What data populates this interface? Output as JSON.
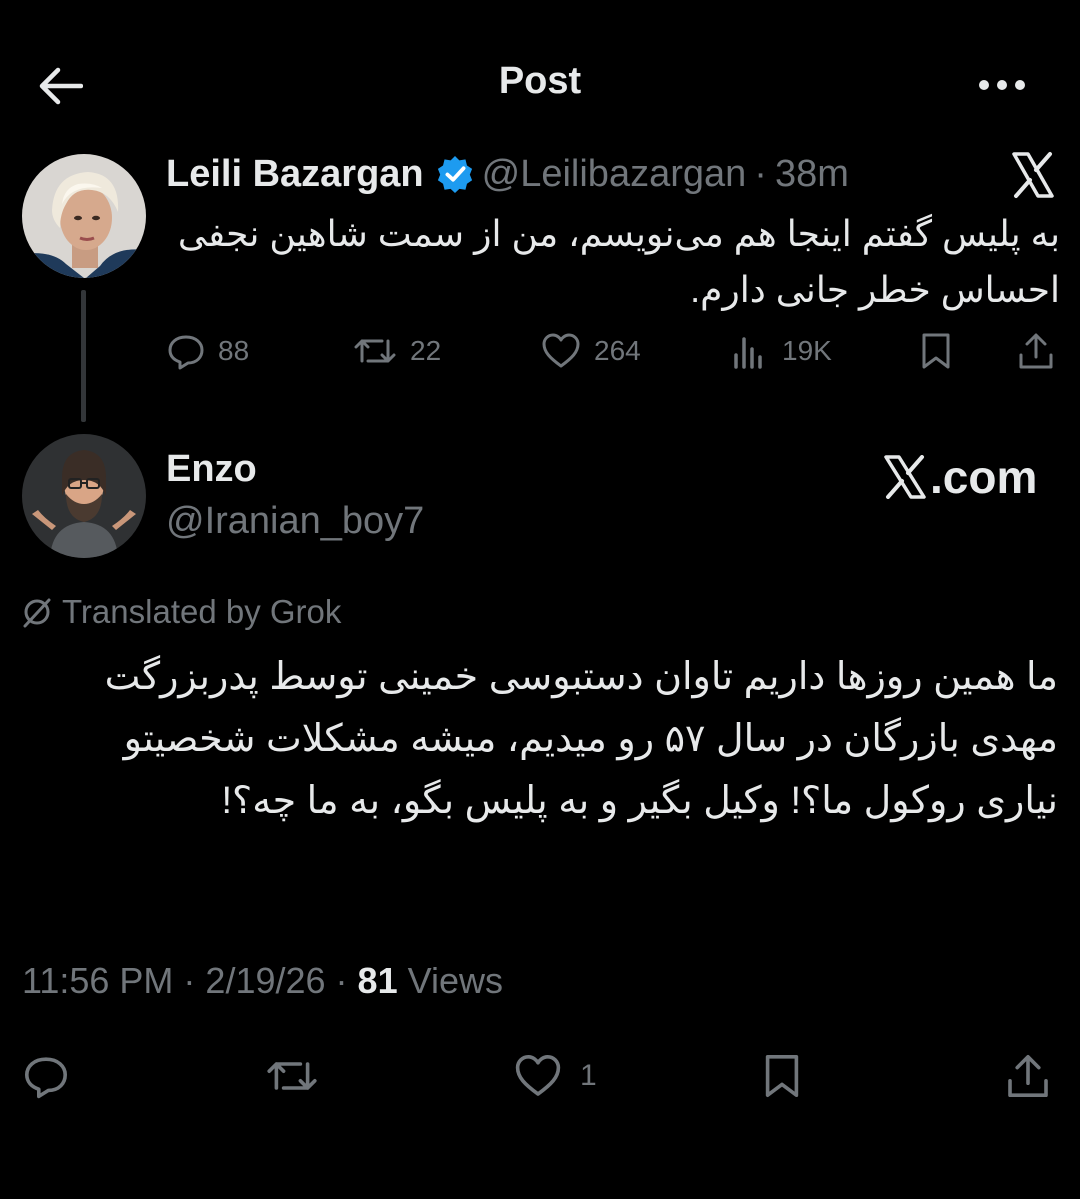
{
  "header": {
    "title": "Post"
  },
  "parent_tweet": {
    "author_name": "Leili Bazargan",
    "handle": "@Leilibazargan",
    "separator": "·",
    "time_ago": "38m",
    "text": "به پلیس گفتم اینجا هم می‌نویسم، من از سمت شاهین نجفی احساس خطر جانی دارم.",
    "stats": {
      "replies": "88",
      "reposts": "22",
      "likes": "264",
      "views": "19K"
    }
  },
  "reply_tweet": {
    "author_name": "Enzo",
    "handle": "@Iranian_boy7",
    "watermark": ".com",
    "translated_label": "Translated by Grok",
    "text": "ما همین روزها داریم تاوان دستبوسی خمینی توسط پدربزرگت مهدی بازرگان در سال ۵۷ رو میدیم، میشه مشکلات شخصیتو نیاری روکول ما؟! وکیل بگیر و به پلیس بگو، به ما چه؟!",
    "time": "11:56 PM",
    "meta_sep": " · ",
    "date": "2/19/26",
    "views_count": "81",
    "views_label": " Views",
    "stats": {
      "likes": "1"
    }
  },
  "colors": {
    "background": "#000000",
    "text_primary": "#e7e9ea",
    "text_secondary": "#71767b",
    "verified": "#1d9bf0",
    "thread_line": "#333639"
  }
}
